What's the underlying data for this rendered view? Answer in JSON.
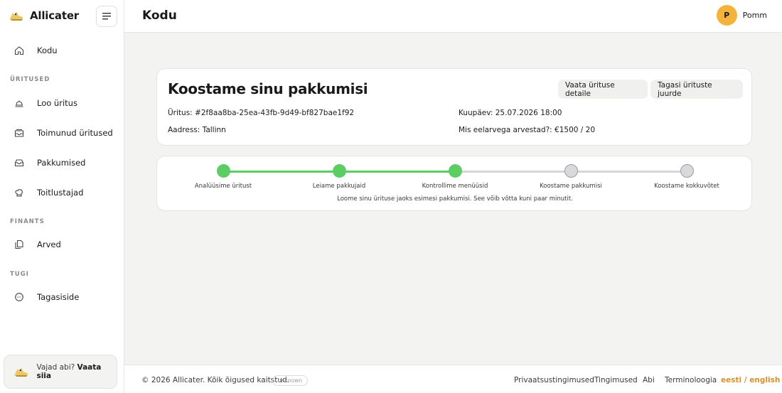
{
  "brand": {
    "name": "Allicater"
  },
  "sidebar": {
    "home": {
      "label": "Kodu",
      "icon": "home-icon"
    },
    "sections": {
      "events": "ÜRITUSED",
      "finance": "FINANTS",
      "support": "TUGI"
    },
    "items": [
      {
        "label": "Loo üritus",
        "icon": "cloche-icon"
      },
      {
        "label": "Toimunud üritused",
        "icon": "inbox-icon"
      },
      {
        "label": "Pakkumised",
        "icon": "tray-icon"
      },
      {
        "label": "Toitlustajad",
        "icon": "chef-hat-icon"
      },
      {
        "label": "Arved",
        "icon": "documents-icon"
      },
      {
        "label": "Tagasiside",
        "icon": "chat-bubble-icon"
      }
    ],
    "help": {
      "text": "Vajad abi?",
      "link": "Vaata siia"
    }
  },
  "header": {
    "title": "Kodu",
    "user": {
      "initial": "P",
      "name": "Pomm"
    }
  },
  "offer_card": {
    "title": "Koostame sinu pakkumisi",
    "buttons": {
      "details": "Vaata ürituse detaile",
      "back": "Tagasi ürituste juurde"
    },
    "event": "Üritus: #2f8aa8ba-25ea-43fb-9d49-bf827bae1f92",
    "date": "Kuupäev: 25.07.2026 18:00",
    "address": "Aadress: Tallinn",
    "budget": "Mis eelarvega arvestad?: €1500 / 20"
  },
  "progress": {
    "steps": [
      {
        "label": "Analüüsime üritust",
        "done": true
      },
      {
        "label": "Leiame pakkujaid",
        "done": true
      },
      {
        "label": "Kontrollime menüüsid",
        "done": true
      },
      {
        "label": "Koostame pakkumisi",
        "done": false
      },
      {
        "label": "Koostame kokkuvõtet",
        "done": false
      }
    ],
    "note": "Loome sinu ürituse jaoks esimesi pakkumisi. See võib võtta kuni paar minutit."
  },
  "footer": {
    "copyright": "© 2026 Allicater. Kõik õigused kaitstud.",
    "badge": "unknown",
    "links": [
      "Privaatsustingimused",
      "Tingimused",
      "Abi",
      "Terminoloogia"
    ],
    "language": "eesti / english"
  },
  "colors": {
    "accent": "#5ccd63",
    "avatar": "#f4b43b",
    "language": "#d8902a"
  }
}
